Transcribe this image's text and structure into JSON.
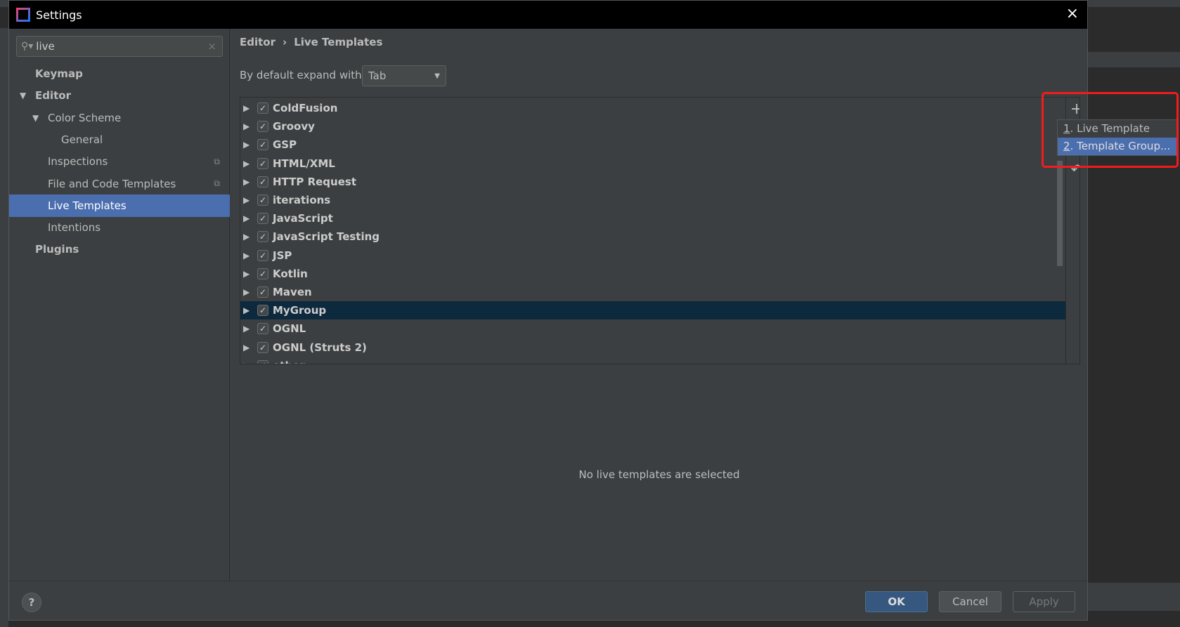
{
  "window": {
    "title": "Settings",
    "close": "×"
  },
  "search": {
    "value": "live",
    "icon": "search-icon",
    "clear": "×"
  },
  "tree": [
    {
      "label": "Keymap",
      "level": 0,
      "bold": true
    },
    {
      "label": "Editor",
      "level": 0,
      "bold": true,
      "expanded": true
    },
    {
      "label": "Color Scheme",
      "level": 1,
      "expanded": true
    },
    {
      "label": "General",
      "level": 2
    },
    {
      "label": "Inspections",
      "level": 1,
      "copy": true
    },
    {
      "label": "File and Code Templates",
      "level": 1,
      "copy": true
    },
    {
      "label": "Live Templates",
      "level": 1,
      "selected": true
    },
    {
      "label": "Intentions",
      "level": 1
    },
    {
      "label": "Plugins",
      "level": 0,
      "bold": true
    }
  ],
  "breadcrumb": [
    "Editor",
    "Live Templates"
  ],
  "breadcrumb_sep": "›",
  "expand": {
    "label": "By default expand with",
    "value": "Tab"
  },
  "groups": [
    {
      "name": "ColdFusion",
      "checked": true
    },
    {
      "name": "Groovy",
      "checked": true
    },
    {
      "name": "GSP",
      "checked": true
    },
    {
      "name": "HTML/XML",
      "checked": true
    },
    {
      "name": "HTTP Request",
      "checked": true
    },
    {
      "name": "iterations",
      "checked": true
    },
    {
      "name": "JavaScript",
      "checked": true
    },
    {
      "name": "JavaScript Testing",
      "checked": true
    },
    {
      "name": "JSP",
      "checked": true
    },
    {
      "name": "Kotlin",
      "checked": true
    },
    {
      "name": "Maven",
      "checked": true
    },
    {
      "name": "MyGroup",
      "checked": true,
      "selected": true
    },
    {
      "name": "OGNL",
      "checked": true
    },
    {
      "name": "OGNL (Struts 2)",
      "checked": true
    },
    {
      "name": "other",
      "checked": true
    }
  ],
  "toolbar": {
    "add": "+",
    "remove": "−",
    "revert": "↶"
  },
  "popup": {
    "items": [
      {
        "num": "1",
        "label": ". Live Template"
      },
      {
        "num": "2",
        "label": ". Template Group..."
      }
    ]
  },
  "message": "No live templates are selected",
  "footer": {
    "help": "?",
    "ok": "OK",
    "cancel": "Cancel",
    "apply": "Apply"
  },
  "colors": {
    "accent": "#4b6eaf",
    "highlight_box": "#f21c1c",
    "selected_row": "#0d293e"
  }
}
